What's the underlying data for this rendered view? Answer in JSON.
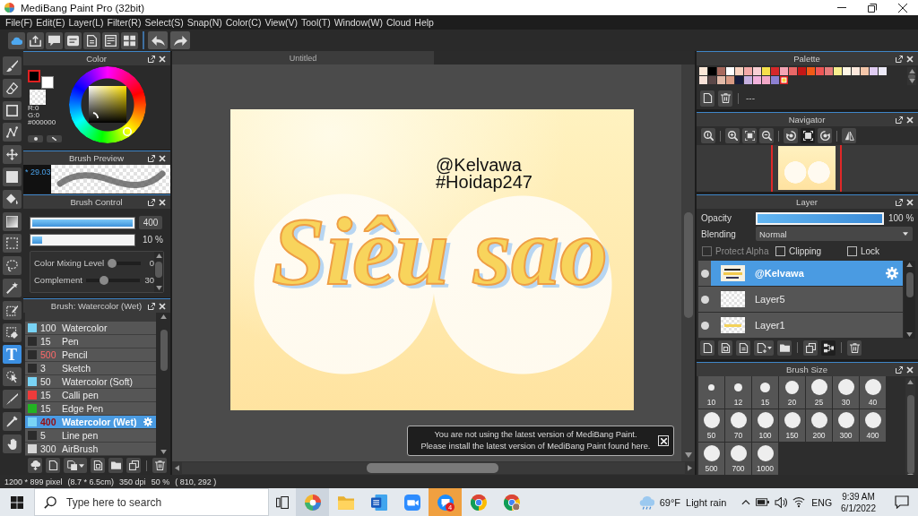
{
  "window": {
    "title": "MediBang Paint Pro (32bit)"
  },
  "menu": [
    "File(F)",
    "Edit(E)",
    "Layer(L)",
    "Filter(R)",
    "Select(S)",
    "Snap(N)",
    "Color(C)",
    "View(V)",
    "Tool(T)",
    "Window(W)",
    "Cloud",
    "Help"
  ],
  "tools": [
    {
      "kind": "brush",
      "selected": false
    },
    {
      "kind": "eraser",
      "selected": false
    },
    {
      "kind": "rectangle",
      "selected": false
    },
    {
      "kind": "polyline",
      "selected": false
    },
    {
      "kind": "move",
      "selected": false
    },
    {
      "kind": "fill",
      "selected": false
    },
    {
      "kind": "bucket",
      "selected": false
    },
    {
      "kind": "gradient",
      "selected": false
    },
    {
      "kind": "select",
      "selected": false
    },
    {
      "kind": "lasso",
      "selected": false
    },
    {
      "kind": "wand",
      "selected": false
    },
    {
      "kind": "select_pen",
      "selected": false
    },
    {
      "kind": "select_eraser",
      "selected": false
    },
    {
      "kind": "text",
      "glyph": "T",
      "selected": true
    },
    {
      "kind": "operation",
      "selected": false
    },
    {
      "kind": "knife",
      "selected": false
    },
    {
      "kind": "dropper",
      "selected": false
    },
    {
      "kind": "hand",
      "selected": false
    }
  ],
  "color_panel": {
    "title": "Color",
    "main": {
      "color": "#000000",
      "selected": true
    },
    "sub": {
      "color": "#ffffff",
      "selected": false
    },
    "readouts": [
      "R:0",
      "G:0",
      "#000000"
    ]
  },
  "brush_preview": {
    "title": "Brush Preview",
    "size": "* 29.03"
  },
  "brush_control": {
    "title": "Brush Control",
    "size": {
      "level": 1,
      "reading": "400"
    },
    "opacity": {
      "level": 0.1,
      "reading": "10 %"
    },
    "settings": [
      {
        "label": "Color Mixing Level",
        "level": 0,
        "reading": "0"
      },
      {
        "label": "Complement",
        "level": 0.3,
        "reading": "30"
      }
    ]
  },
  "brush_list": {
    "title": "Brush: Watercolor (Wet)",
    "items": [
      {
        "size": "100",
        "name": "Watercolor",
        "color": "#79d4f6",
        "size_alert": false,
        "selected": false
      },
      {
        "size": "15",
        "name": "Pen",
        "color": "#2b2b2b",
        "size_alert": false,
        "selected": false
      },
      {
        "size": "500",
        "name": "Pencil",
        "color": "#2b2b2b",
        "size_alert": true,
        "selected": false
      },
      {
        "size": "3",
        "name": "Sketch",
        "color": "#2b2b2b",
        "size_alert": false,
        "selected": false
      },
      {
        "size": "50",
        "name": "Watercolor (Soft)",
        "color": "#79d4f6",
        "size_alert": false,
        "selected": false
      },
      {
        "size": "15",
        "name": "Calli pen",
        "color": "#ee3b3b",
        "size_alert": false,
        "selected": false
      },
      {
        "size": "15",
        "name": "Edge Pen",
        "color": "#22b322",
        "size_alert": false,
        "selected": false
      },
      {
        "size": "400",
        "name": "Watercolor (Wet)",
        "color": "#79d4f6",
        "size_alert": true,
        "selected": true
      },
      {
        "size": "5",
        "name": "Line pen",
        "color": "#2b2b2b",
        "size_alert": false,
        "selected": false
      },
      {
        "size": "300",
        "name": "AirBrush",
        "color": "#d6d6d6",
        "size_alert": false,
        "selected": false
      }
    ]
  },
  "canvas": {
    "tab": "Untitled",
    "captions": [
      "@Kelvawa",
      "#Hoidap247"
    ],
    "lettering": "Siêu sao"
  },
  "notification": {
    "lines": [
      "You are not using the latest version of MediBang Paint.",
      "Please install the latest version of MediBang Paint found here."
    ]
  },
  "palette": {
    "title": "Palette",
    "swatches": [
      {
        "color": "#fce8d8",
        "selected": false
      },
      {
        "color": "#000000",
        "selected": false
      },
      {
        "color": "#a86a5e",
        "selected": false
      },
      {
        "color": "#ffffff",
        "selected": false
      },
      {
        "color": "#f8d2c0",
        "selected": false
      },
      {
        "color": "#f4aaa8",
        "selected": false
      },
      {
        "color": "#f8d0d4",
        "selected": false
      },
      {
        "color": "#f6e04a",
        "selected": false
      },
      {
        "color": "#d6282a",
        "selected": false
      },
      {
        "color": "#f4a4b4",
        "selected": false
      },
      {
        "color": "#e86868",
        "selected": false
      },
      {
        "color": "#c41616",
        "selected": false
      },
      {
        "color": "#f25a16",
        "selected": false
      },
      {
        "color": "#f05656",
        "selected": false
      },
      {
        "color": "#e67c7c",
        "selected": false
      },
      {
        "color": "#f8ee8e",
        "selected": false
      },
      {
        "color": "#fff6e6",
        "selected": false
      },
      {
        "color": "#fce8dc",
        "selected": false
      },
      {
        "color": "#f4c6aa",
        "selected": false
      },
      {
        "color": "#e0ccf2",
        "selected": false
      },
      {
        "color": "#eceaf8",
        "selected": false
      },
      {
        "color": "#f8e2d8",
        "selected": false
      },
      {
        "color": "#5c4848",
        "selected": false
      },
      {
        "color": "#e2baa8",
        "selected": false
      },
      {
        "color": "#d89a84",
        "selected": false
      },
      {
        "color": "#161c3c",
        "selected": false
      },
      {
        "color": "#c6b0e0",
        "selected": false
      },
      {
        "color": "#f2b2dc",
        "selected": false
      },
      {
        "color": "#f2a8c8",
        "selected": false
      },
      {
        "color": "#8c80d2",
        "selected": false
      },
      {
        "color": "#f6d23a",
        "selected": true
      }
    ],
    "name": "---"
  },
  "navigator": {
    "title": "Navigator"
  },
  "layer_panel": {
    "title": "Layer",
    "opacity": {
      "label": "Opacity",
      "level": 1,
      "reading": "100 %"
    },
    "blending": {
      "label": "Blending",
      "value": "Normal"
    },
    "options": [
      {
        "label": "Protect Alpha",
        "checked": false,
        "disabled": true
      },
      {
        "label": "Clipping",
        "checked": false,
        "disabled": false
      },
      {
        "label": "Lock",
        "checked": false,
        "disabled": false
      }
    ],
    "layers": [
      {
        "name": "@Kelvawa",
        "kind": "text",
        "visible": true,
        "selected": true
      },
      {
        "name": "Layer5",
        "kind": "empty",
        "visible": true,
        "selected": false
      },
      {
        "name": "Layer1",
        "kind": "art",
        "visible": true,
        "selected": false
      }
    ]
  },
  "brush_size": {
    "title": "Brush Size",
    "sizes": [
      "10",
      "12",
      "15",
      "20",
      "25",
      "30",
      "40",
      "50",
      "70",
      "100",
      "150",
      "200",
      "300",
      "400",
      "500",
      "700",
      "1000"
    ]
  },
  "status_bar": [
    "1200 * 899 pixel",
    "(8.7 * 6.5cm)",
    "350 dpi",
    "50 %",
    "( 810, 292 )"
  ],
  "taskbar": {
    "search": {
      "placeholder": "Type here to search"
    },
    "apps": [
      {
        "kind": "paint",
        "active": true,
        "flashing": false
      },
      {
        "kind": "folder",
        "active": false,
        "flashing": false
      },
      {
        "kind": "document",
        "active": false,
        "flashing": false
      },
      {
        "kind": "video",
        "active": false,
        "flashing": false
      },
      {
        "kind": "chat",
        "active": false,
        "flashing": true,
        "badge": "4"
      },
      {
        "kind": "browser",
        "active": false,
        "flashing": false
      },
      {
        "kind": "browser_profile",
        "active": false,
        "flashing": false
      }
    ],
    "weather": {
      "temperature": "69°F",
      "condition": "Light rain"
    },
    "language": "ENG",
    "time": "9:39 AM",
    "date": "6/1/2022"
  }
}
